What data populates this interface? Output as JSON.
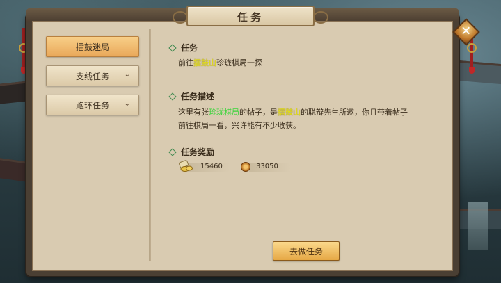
{
  "window": {
    "title": "任务",
    "close_icon": "close-icon"
  },
  "sidebar": {
    "items": [
      {
        "label": "擂鼓迷局",
        "active": true
      },
      {
        "label": "支线任务",
        "expandable": true
      },
      {
        "label": "跑环任务",
        "expandable": true
      }
    ]
  },
  "quest": {
    "task_heading": "任务",
    "task_text": {
      "prefix": "前往",
      "place": "擂鼓山",
      "suffix": "珍珑棋局一探"
    },
    "desc_heading": "任务描述",
    "desc_text": {
      "p1": "这里有张",
      "item": "珍珑棋局",
      "p2": "的帖子，是",
      "place": "擂鼓山",
      "p3": "的聪辩先生所邀，你且带着帖子前往棋局一看，兴许能有不少收获。"
    },
    "reward_heading": "任务奖励",
    "rewards": [
      {
        "icon": "silver-ingot-icon",
        "value": "15460"
      },
      {
        "icon": "copper-coin-icon",
        "value": "33050"
      }
    ],
    "go_button": "去做任务"
  },
  "colors": {
    "highlight_place": "#e6e11a",
    "highlight_item": "#3bd43b",
    "active_tab": "#e9a85a"
  }
}
